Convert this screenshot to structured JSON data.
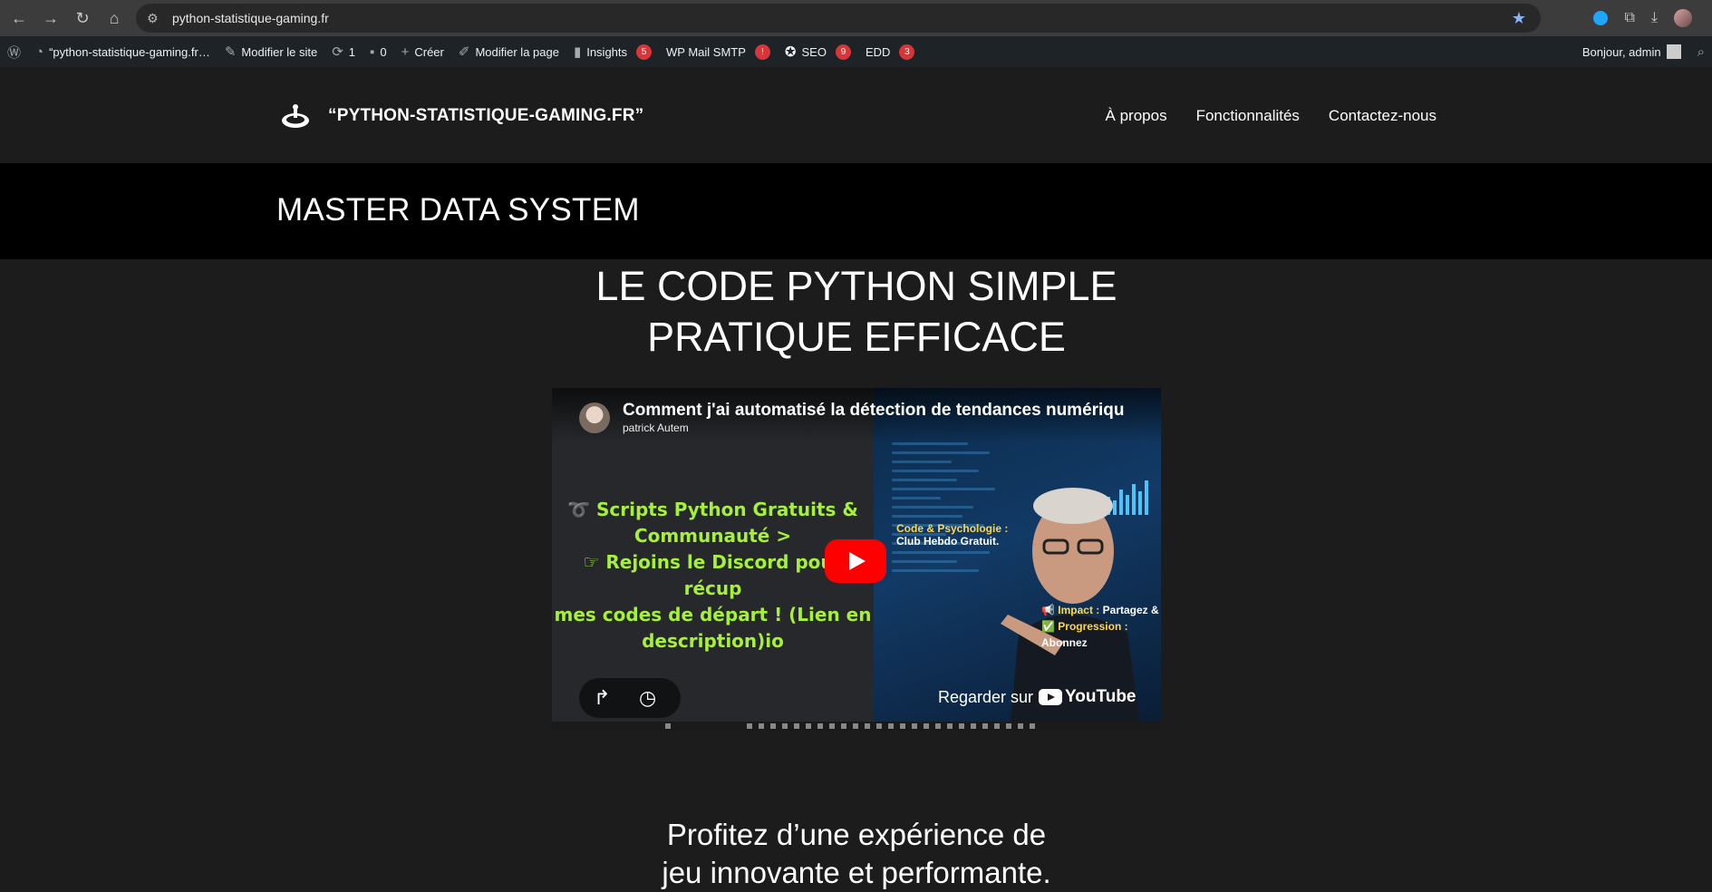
{
  "browser": {
    "url": "python-statistique-gaming.fr"
  },
  "adminbar": {
    "site_name": "“python-statistique-gaming.fr…",
    "customize": "Modifier le site",
    "updates_count": "1",
    "comments_count": "0",
    "new": "Créer",
    "edit_page": "Modifier la page",
    "insights": "Insights",
    "insights_badge": "5",
    "wp_mail": "WP Mail SMTP",
    "wp_mail_badge": "!",
    "seo": "SEO",
    "seo_badge": "9",
    "edd": "EDD",
    "edd_badge": "3",
    "greeting": "Bonjour, admin"
  },
  "site": {
    "title": "“PYTHON-STATISTIQUE-GAMING.FR”",
    "menu": [
      "À propos",
      "Fonctionnalités",
      "Contactez-nous"
    ]
  },
  "hero": {
    "page_title": "MASTER DATA SYSTEM",
    "headline_line1": "LE CODE PYTHON SIMPLE",
    "headline_line2": "PRATIQUE EFFICACE"
  },
  "video": {
    "title": "Comment j'ai automatisé la détection de tendances numériqu",
    "channel": "patrick Autem",
    "overlay_line1": "➰ Scripts Python Gratuits &",
    "overlay_line2": "Communauté >",
    "overlay_line3": "☞ Rejoins le Discord pour récup",
    "overlay_line4": "mes codes de départ ! (Lien en",
    "overlay_line5": "description)io",
    "tag1_highlight": "Code & Psychologie :",
    "tag1_text": "Club Hebdo Gratuit.",
    "tag2_line1_highlight": "📢 Impact :",
    "tag2_line1_text": "Partagez &",
    "tag2_line2_highlight": "✅ Progression :",
    "tag2_line2_text": "Abonnez",
    "watch_on": "Regarder sur",
    "youtube": "YouTube"
  },
  "content": {
    "subtitle_line1": "Profitez d’une expérience de",
    "subtitle_line2": "jeu innovante et performante."
  }
}
